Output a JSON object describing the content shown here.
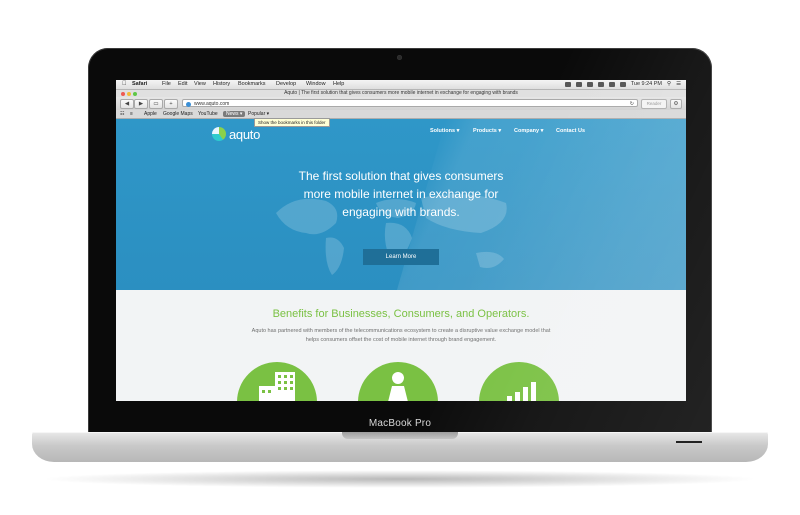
{
  "device": {
    "brand_label": "MacBook Pro"
  },
  "os_menubar": {
    "app_name": "Safari",
    "menus": [
      "File",
      "Edit",
      "View",
      "History",
      "Bookmarks",
      "Develop",
      "Window",
      "Help"
    ],
    "clock": "Tue 9:24 PM"
  },
  "browser": {
    "window_title": "Aquto | The first solution that gives consumers more mobile internet in exchange for engaging with brands",
    "url": "www.aquto.com",
    "reader_label": "Reader",
    "bookmarks": [
      "Apple",
      "Google Maps",
      "YouTube",
      "News",
      "Popular"
    ],
    "tooltip": "Show the bookmarks in this folder"
  },
  "site": {
    "logo_text": "aquto",
    "nav": [
      "Solutions",
      "Products",
      "Company",
      "Contact Us"
    ],
    "headline_lines": [
      "The first solution that gives consumers",
      "more mobile internet in exchange for",
      "engaging with brands."
    ],
    "cta_label": "Learn More",
    "benefits_title": "Benefits for Businesses, Consumers, and Operators.",
    "benefits_body_lines": [
      "Aquto has partnered with members of the telecommunications ecosystem to create a disruptive value exchange model that",
      "helps consumers offset the cost of mobile internet through brand engagement."
    ],
    "icons": [
      "building-icon",
      "person-icon",
      "bar-chart-icon"
    ]
  },
  "colors": {
    "hero_blue": "#2f97c8",
    "cta_blue": "#1f6f98",
    "brand_green": "#7ac143",
    "page_bg": "#f2f4f5"
  }
}
